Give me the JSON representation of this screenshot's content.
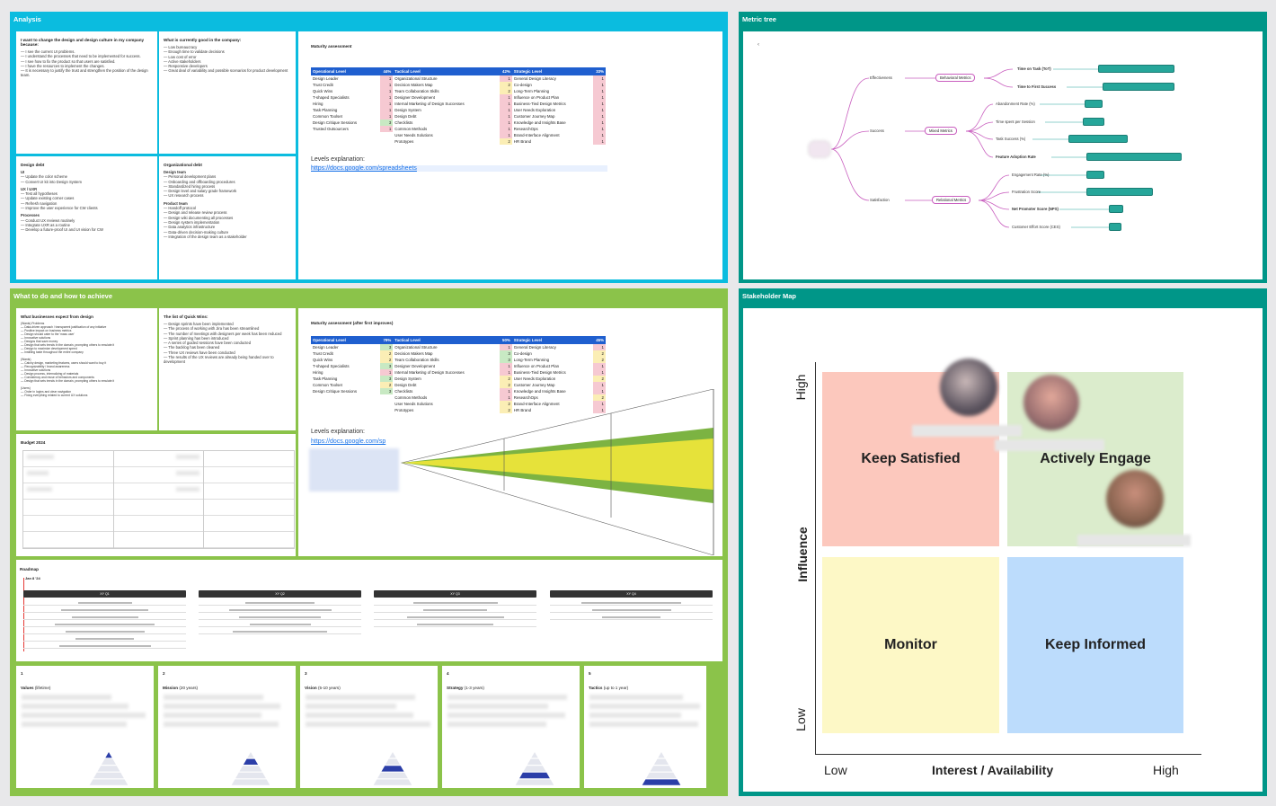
{
  "frames": {
    "analysis": "Analysis",
    "metric_tree": "Metric tree",
    "what_to_do": "What to do and how to achieve",
    "stakeholder": "Stakeholder Map"
  },
  "analysis": {
    "why": {
      "title": "I want to change the design and design culture in my company because:",
      "body": "— I see the current UI problems.\n— I understand the processes that need to be implemented for success.\n— I see how to fix the product so that users are satisfied.\n— I have the resources to implement the changes.\n— It is necessary to justify the trust and strengthen the position of the design team."
    },
    "good": {
      "title": "What is currently good in the company:",
      "body": "— Low bureaucracy\n— Enough time to validate decisions\n— Low cost of error\n— Active stakeholders\n— Responsive developers\n— Great deal of variability and possible scenarios for product development"
    },
    "design_debt": {
      "title": "Design debt",
      "ui": "UI",
      "ui_body": "— Update the color scheme\n— Convert UI kit into Design System",
      "uxr": "UX / UXR",
      "uxr_body": "— Test all hypotheses\n— Update existing corner cases\n— Refresh navigation\n— Improve the user experience for CW clients",
      "proc": "Processes",
      "proc_body": "— Conduct UX reviews routinely\n— Integrate UXR as a routine\n— Develop a future-proof UI and UI vision for CW"
    },
    "org_debt": {
      "title": "Organizational debt",
      "team": "Design team",
      "team_body": "— Personal development plans\n— Onboarding and offboarding procedures\n— Standardized hiring process\n— Design level and salary grade framework\n— UX research process",
      "product": "Product team",
      "product_body": "— Handoff protocol\n— Design and release review process\n— Design wiki documenting all processes\n— Design system implementation\n— Data analytics infrastructure\n— Data-driven decision-making culture\n— Integration of the design team as a stakeholder"
    },
    "maturity": {
      "title": "Maturity assessment",
      "headers": [
        [
          "Operational Level",
          "44%"
        ],
        [
          "Tactical Level",
          "42%"
        ],
        [
          "Strategic Level",
          "33%"
        ]
      ],
      "rows": [
        [
          "Design Leader",
          "1",
          "Organizational Structure",
          "1",
          "General Design Literacy",
          "1"
        ],
        [
          "Trust Credit",
          "1",
          "Decision Makers Map",
          "2",
          "Co-design",
          "1"
        ],
        [
          "Quick Wins",
          "1",
          "Team Collaboration Skills",
          "2",
          "Long-Term Planning",
          "1"
        ],
        [
          "T-shaped Specialists",
          "1",
          "Designer Development",
          "1",
          "Influence on Product Plan",
          "1"
        ],
        [
          "Hiring",
          "1",
          "Internal Marketing of Design Successes",
          "1",
          "Business-Tied Design Metrics",
          "1"
        ],
        [
          "Task Planning",
          "1",
          "Design System",
          "1",
          "User Needs Exploration",
          "1"
        ],
        [
          "Common Toolset",
          "1",
          "Design Debt",
          "1",
          "Customer Journey Map",
          "1"
        ],
        [
          "Design Critique Sessions",
          "3",
          "Checklists",
          "1",
          "Knowledge and Insights Base",
          "1"
        ],
        [
          "Trusted Outsourcers",
          "1",
          "Common Methods",
          "1",
          "ResearchOps",
          "1"
        ],
        [
          "",
          "",
          "User Needs Solutions",
          "1",
          "Brand-Interface Alignment",
          "1"
        ],
        [
          "",
          "",
          "Prototypes",
          "2",
          "HR Brand",
          "1"
        ]
      ],
      "levels_label": "Levels explanation:",
      "link": "https://docs.google.com/spreadsheets"
    }
  },
  "metric_tree": {
    "root_mark": "‹",
    "branches": [
      "Effectiveness",
      "Success",
      "Satisfaction"
    ],
    "groups": [
      "Behavioral Metrics",
      "Mixed Metrics",
      "Relational Metrics"
    ],
    "metrics": [
      "Time on Task (ToT)",
      "Time to First Success",
      "Abandonment Rate (%)",
      "Time spent per Session",
      "Task Success (%)",
      "Feature Adoption Rate",
      "Engagement Rate (%)",
      "Frustration Score",
      "Net Promoter Score (NPS)",
      "Customer Effort Score (CES)"
    ]
  },
  "what": {
    "expect": {
      "title": "What businesses expect from design",
      "body": "(Wants) Problems\n— Data-driven approach / transparent justification of any initiative\n— Positive impact on business metrics\n— Design should cater to the 'mass user'\n— Innovative solutions\n— Designs that save money\n— Design that sets trends in the domain, prompting others to emulate it\n— Design to maximize development speed\n— Instilling taste throughout the entire company\n\n(Wants)\n— Catchy design, marketing features, users should want to buy it\n— Recognizability / brand awareness\n— Innovative solutions\n— Design process, internalizing of materials\n— Consistency and reuse of behaviors and components\n— Design that sets trends in the domain, prompting others to emulate it\n\n(Users)\n— Order in logins and clear navigation\n— Fixing everything related to current UX solutions"
    },
    "quick": {
      "title": "The list of Quick Wins:",
      "body": "— Design sprints have been implemented\n— The process of working with Jira has been streamlined\n— The number of meetings with designers per week has been reduced\n— Sprint planning has been introduced\n— A series of guided sessions have been conducted\n— The backlog has been cleaned\n— Three UX reviews have been conducted\n— The results of the UX reviews are already being handed over to development"
    },
    "maturity2": {
      "title": "Maturity assessment (after first improves)",
      "headers": [
        [
          "Operational Level",
          "79%"
        ],
        [
          "Tactical Level",
          "50%"
        ],
        [
          "Strategic Level",
          "45%"
        ]
      ],
      "rows": [
        [
          "Design Leader",
          "3",
          "Organizational Structure",
          "1",
          "General Design Literacy",
          "1"
        ],
        [
          "Trust Credit",
          "2",
          "Decision Makers Map",
          "3",
          "Co-design",
          "2"
        ],
        [
          "Quick Wins",
          "2",
          "Team Collaboration Skills",
          "3",
          "Long-Term Planning",
          "2"
        ],
        [
          "T-shaped Specialists",
          "3",
          "Designer Development",
          "1",
          "Influence on Product Plan",
          "1"
        ],
        [
          "Hiring",
          "1",
          "Internal Marketing of Design Successes",
          "1",
          "Business-Tied Design Metrics",
          "1"
        ],
        [
          "Task Planning",
          "3",
          "Design System",
          "2",
          "User Needs Exploration",
          "2"
        ],
        [
          "Common Toolset",
          "2",
          "Design Debt",
          "2",
          "Customer Journey Map",
          "1"
        ],
        [
          "Design Critique Sessions",
          "3",
          "Checklists",
          "1",
          "Knowledge and Insights Base",
          "1"
        ],
        [
          "",
          "",
          "Common Methods",
          "1",
          "ResearchOps",
          "2"
        ],
        [
          "",
          "",
          "User Needs Solutions",
          "2",
          "Brand-Interface Alignment",
          "1"
        ],
        [
          "",
          "",
          "Prototypes",
          "2",
          "HR Brand",
          "1"
        ]
      ],
      "levels_label": "Levels explanation:",
      "link": "https://docs.google.com/sp"
    },
    "budget": "Budget 2024",
    "roadmap": {
      "title": "Roadmap",
      "start": "Jan 8 '24",
      "quarters": [
        "XY Q1",
        "XY Q2",
        "XY Q3",
        "XY Q4"
      ]
    },
    "pyramid": [
      {
        "n": "1",
        "t": "Values",
        "s": "(lifetime)"
      },
      {
        "n": "2",
        "t": "Mission",
        "s": "(20 years)"
      },
      {
        "n": "3",
        "t": "Vision",
        "s": "(5-10 years)"
      },
      {
        "n": "4",
        "t": "Strategy",
        "s": "(1-3 years)"
      },
      {
        "n": "5",
        "t": "Tactics",
        "s": "(up to 1 year)"
      }
    ]
  },
  "stakeholder": {
    "quadrants": [
      "Keep Satisfied",
      "Actively Engage",
      "Monitor",
      "Keep Informed"
    ],
    "y_axis": "Influence",
    "y_high": "High",
    "y_low": "Low",
    "x_axis": "Interest / Availability",
    "x_low": "Low",
    "x_high": "High",
    "colors": {
      "keep_satisfied": "#fcc8bd",
      "actively_engage": "#dbeccc",
      "monitor": "#fdf8c6",
      "keep_informed": "#bcdcfc"
    }
  }
}
